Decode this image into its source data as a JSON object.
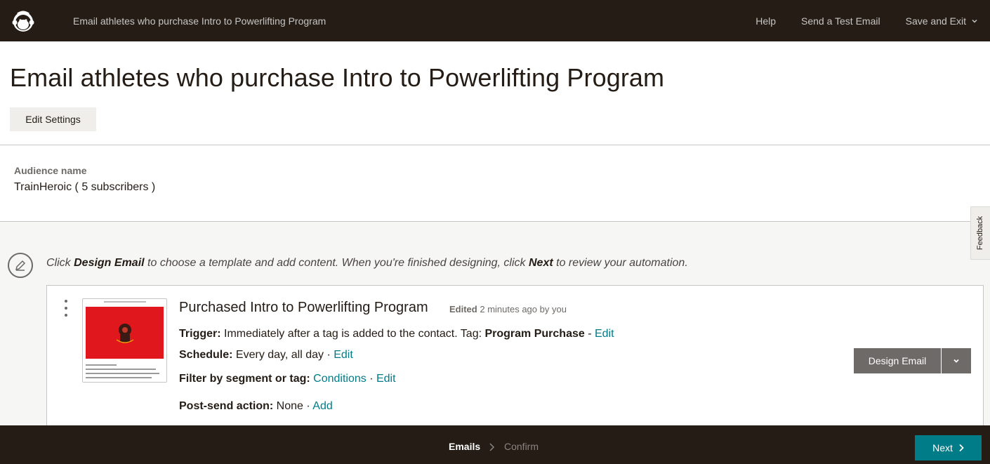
{
  "topbar": {
    "logo_icon": "mailchimp-freddie-icon",
    "title": "Email athletes who purchase Intro to Powerlifting Program",
    "help": "Help",
    "send_test": "Send a Test Email",
    "save_exit": "Save and Exit"
  },
  "header": {
    "title": "Email athletes who purchase Intro to Powerlifting Program",
    "edit_settings": "Edit Settings"
  },
  "audience": {
    "label": "Audience name",
    "value": "TrainHeroic ( 5 subscribers )"
  },
  "hint": {
    "pre": "Click ",
    "design_email": "Design Email",
    "mid": " to choose a template and add content. When you're finished designing, click ",
    "next": "Next",
    "post": " to review your automation."
  },
  "feedback": "Feedback",
  "email": {
    "name": "Purchased Intro to Powerlifting Program",
    "edited_label": "Edited",
    "edited_time": " 2 minutes ago by you",
    "trigger_label": "Trigger:",
    "trigger_text": " Immediately after a tag is added to the contact. Tag: ",
    "trigger_tag": "Program Purchase",
    "trigger_sep": " - ",
    "trigger_edit": "Edit",
    "schedule_label": "Schedule:",
    "schedule_text": " Every day, all day · ",
    "schedule_edit": "Edit",
    "filter_label": "Filter by segment or tag:",
    "filter_conditions": "Conditions",
    "filter_sep": " · ",
    "filter_edit": "Edit",
    "postsend_label": "Post-send action:",
    "postsend_text": " None · ",
    "postsend_add": "Add",
    "design_button": "Design Email"
  },
  "colors": {
    "dark": "#241c15",
    "teal": "#007c89",
    "gray_button": "#6d6a67",
    "thumb_red": "#e0181e"
  },
  "footer": {
    "step1": "Emails",
    "step2": "Confirm",
    "next": "Next"
  }
}
